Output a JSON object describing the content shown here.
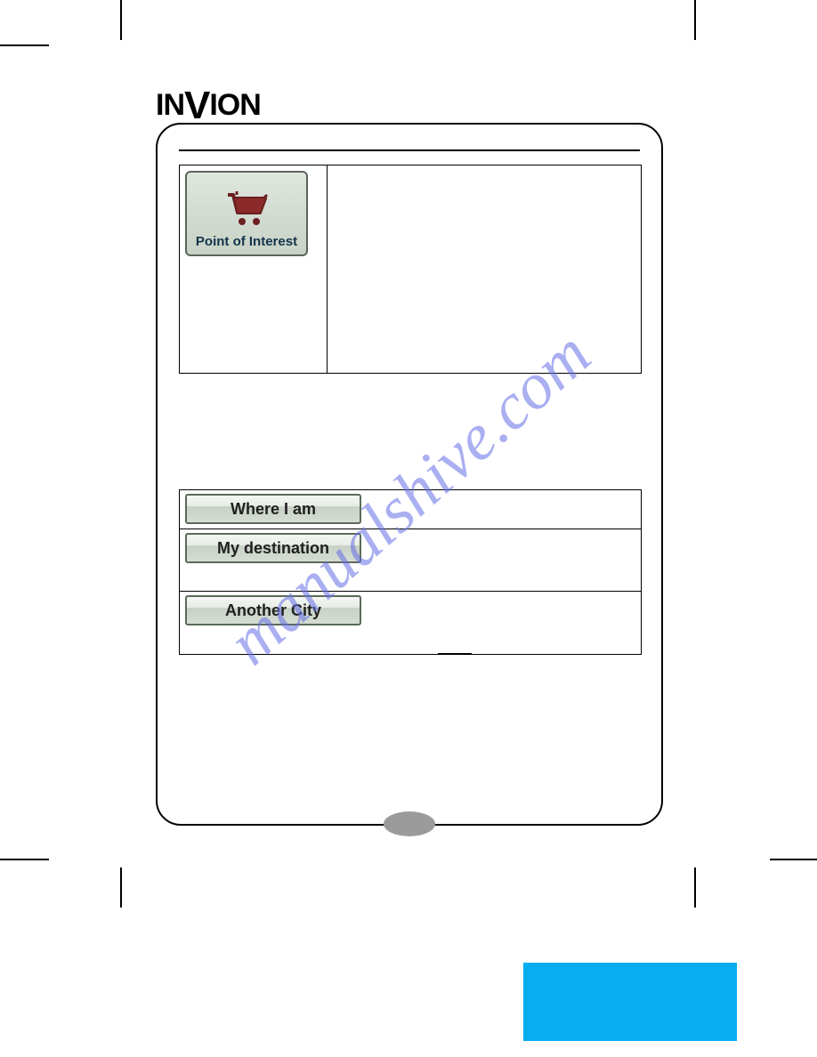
{
  "logo_text": "INVION",
  "poi_button_label": "Point of Interest",
  "location_table": {
    "rows": [
      {
        "label": "Where I am"
      },
      {
        "label": "My destination"
      },
      {
        "label": "Another City"
      }
    ]
  },
  "watermark_text": "manualshive.com"
}
